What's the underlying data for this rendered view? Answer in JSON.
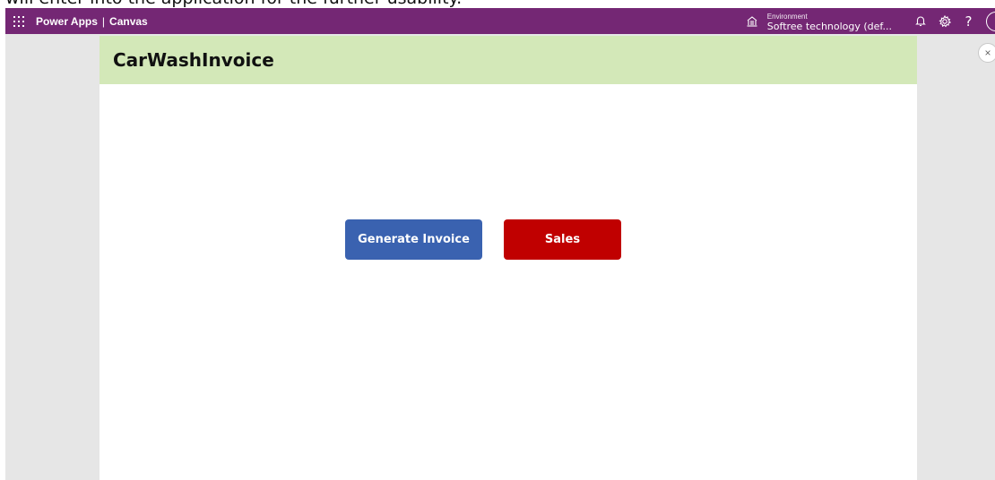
{
  "document": {
    "partial_text": "will enter into the application for the further usability."
  },
  "topbar": {
    "app_name": "Power Apps",
    "separator": "|",
    "section": "Canvas",
    "environment_label": "Environment",
    "environment_value": "Softree technology (def...",
    "help_label": "?",
    "background_color": "#742774",
    "icons": [
      "waffle-icon",
      "environment-icon",
      "notifications-icon",
      "settings-icon",
      "help-icon",
      "avatar"
    ]
  },
  "app": {
    "title": "CarWashInvoice",
    "header_color": "#d3e8b8",
    "buttons": {
      "generate_invoice": "Generate Invoice",
      "sales": "Sales"
    },
    "colors": {
      "generate_invoice": "#3a62b0",
      "sales": "#c00000"
    }
  },
  "close": {
    "label": "×"
  }
}
